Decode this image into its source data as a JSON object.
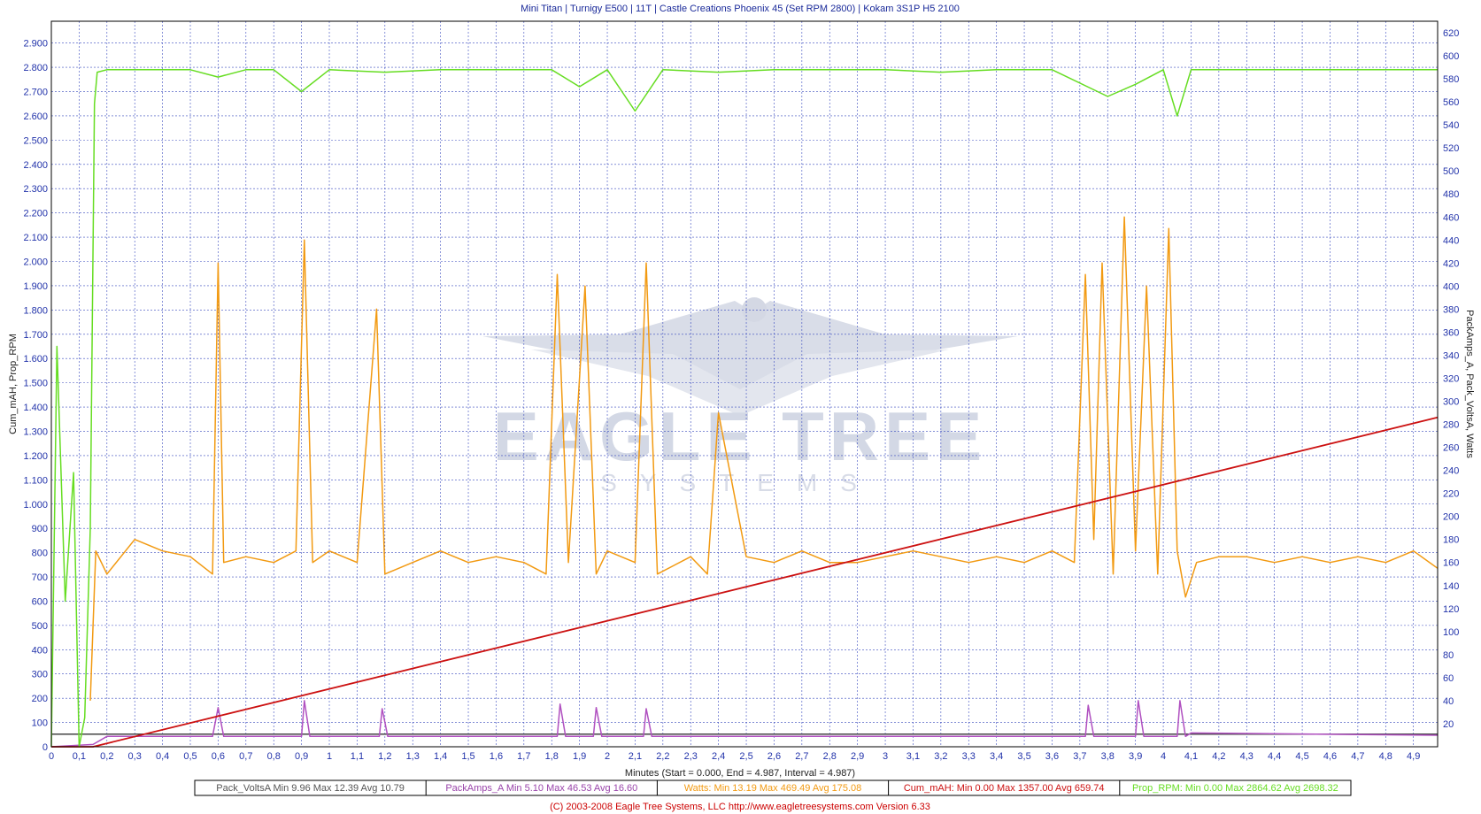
{
  "chart_data": {
    "type": "line",
    "title": "Mini Titan | Turnigy E500 | 11T | Castle Creations Phoenix 45 (Set RPM 2800) | Kokam 3S1P H5 2100",
    "xlabel": "Minutes (Start = 0.000,  End = 4.987,  Interval =  4.987)",
    "ylabel_left": "Cum_mAH, Prop_RPM",
    "ylabel_right": "PackAmps_A, Pack_VoltsA, Watts",
    "xlim": [
      0,
      4.987
    ],
    "ylim_left": [
      0,
      2990
    ],
    "ylim_right": [
      0,
      630
    ],
    "x_ticks": [
      "0",
      "0,1",
      "0,2",
      "0,3",
      "0,4",
      "0,5",
      "0,6",
      "0,7",
      "0,8",
      "0,9",
      "1",
      "1,1",
      "1,2",
      "1,3",
      "1,4",
      "1,5",
      "1,6",
      "1,7",
      "1,8",
      "1,9",
      "2",
      "2,1",
      "2,2",
      "2,3",
      "2,4",
      "2,5",
      "2,6",
      "2,7",
      "2,8",
      "2,9",
      "3",
      "3,1",
      "3,2",
      "3,3",
      "3,4",
      "3,5",
      "3,6",
      "3,7",
      "3,8",
      "3,9",
      "4",
      "4,1",
      "4,2",
      "4,3",
      "4,4",
      "4,5",
      "4,6",
      "4,7",
      "4,8",
      "4,9"
    ],
    "y_left_ticks": [
      "0",
      "100",
      "200",
      "300",
      "400",
      "500",
      "600",
      "700",
      "800",
      "900",
      "1.000",
      "1.100",
      "1.200",
      "1.300",
      "1.400",
      "1.500",
      "1.600",
      "1.700",
      "1.800",
      "1.900",
      "2.000",
      "2.100",
      "2.200",
      "2.300",
      "2.400",
      "2.500",
      "2.600",
      "2.700",
      "2.800",
      "2.900"
    ],
    "y_right_ticks": [
      "20",
      "40",
      "60",
      "80",
      "100",
      "120",
      "140",
      "160",
      "180",
      "200",
      "220",
      "240",
      "260",
      "280",
      "300",
      "320",
      "340",
      "360",
      "380",
      "400",
      "420",
      "440",
      "460",
      "480",
      "500",
      "520",
      "540",
      "560",
      "580",
      "600",
      "620"
    ],
    "grid": true,
    "series": [
      {
        "name": "Prop_RPM",
        "axis": "left",
        "color": "#66dd22",
        "x": [
          0,
          0.02,
          0.05,
          0.08,
          0.1,
          0.12,
          0.14,
          0.155,
          0.165,
          0.2,
          0.3,
          0.4,
          0.5,
          0.6,
          0.7,
          0.8,
          0.9,
          1.0,
          1.2,
          1.4,
          1.6,
          1.8,
          1.9,
          2.0,
          2.1,
          2.2,
          2.4,
          2.6,
          2.8,
          3.0,
          3.2,
          3.4,
          3.6,
          3.8,
          3.9,
          4.0,
          4.05,
          4.1,
          4.3,
          4.5,
          4.7,
          4.9,
          4.987
        ],
        "values": [
          0,
          1650,
          600,
          1130,
          0,
          120,
          900,
          2650,
          2780,
          2790,
          2790,
          2790,
          2790,
          2760,
          2790,
          2790,
          2700,
          2790,
          2780,
          2790,
          2790,
          2790,
          2720,
          2790,
          2620,
          2790,
          2780,
          2790,
          2790,
          2790,
          2780,
          2790,
          2790,
          2680,
          2730,
          2790,
          2600,
          2790,
          2790,
          2790,
          2790,
          2790,
          2790
        ]
      },
      {
        "name": "Watts",
        "axis": "right",
        "color": "#f29a12",
        "x": [
          0.14,
          0.16,
          0.2,
          0.3,
          0.4,
          0.5,
          0.58,
          0.6,
          0.62,
          0.7,
          0.8,
          0.88,
          0.91,
          0.94,
          1.0,
          1.1,
          1.17,
          1.2,
          1.3,
          1.4,
          1.5,
          1.6,
          1.7,
          1.78,
          1.82,
          1.86,
          1.92,
          1.96,
          2.0,
          2.1,
          2.14,
          2.18,
          2.3,
          2.36,
          2.4,
          2.5,
          2.6,
          2.7,
          2.8,
          2.9,
          3.0,
          3.1,
          3.2,
          3.3,
          3.4,
          3.5,
          3.6,
          3.68,
          3.72,
          3.75,
          3.78,
          3.82,
          3.86,
          3.9,
          3.94,
          3.98,
          4.02,
          4.05,
          4.08,
          4.12,
          4.2,
          4.3,
          4.4,
          4.5,
          4.6,
          4.7,
          4.8,
          4.9,
          4.987
        ],
        "values": [
          40,
          170,
          150,
          180,
          170,
          165,
          150,
          420,
          160,
          165,
          160,
          170,
          440,
          160,
          170,
          160,
          380,
          150,
          160,
          170,
          160,
          165,
          160,
          150,
          410,
          160,
          400,
          150,
          170,
          160,
          420,
          150,
          165,
          150,
          290,
          165,
          160,
          170,
          160,
          160,
          165,
          170,
          165,
          160,
          165,
          160,
          170,
          160,
          410,
          180,
          420,
          150,
          460,
          170,
          400,
          150,
          450,
          170,
          130,
          160,
          165,
          165,
          160,
          165,
          160,
          165,
          160,
          170,
          155
        ]
      },
      {
        "name": "Cum_mAH",
        "axis": "left",
        "color": "#cc1111",
        "x": [
          0,
          0.15,
          4.987
        ],
        "values": [
          0,
          0,
          1357
        ]
      },
      {
        "name": "PackAmps_A",
        "axis": "right",
        "color": "#b050c0",
        "x": [
          0,
          0.15,
          0.2,
          0.58,
          0.6,
          0.62,
          0.9,
          0.91,
          0.93,
          1.18,
          1.19,
          1.21,
          1.82,
          1.83,
          1.85,
          1.95,
          1.96,
          1.98,
          2.13,
          2.14,
          2.16,
          3.72,
          3.73,
          3.75,
          3.9,
          3.91,
          3.93,
          4.05,
          4.06,
          4.08,
          4.1,
          4.987
        ],
        "values": [
          0,
          2,
          9,
          9,
          34,
          9,
          9,
          40,
          9,
          9,
          33,
          9,
          9,
          37,
          9,
          9,
          34,
          9,
          9,
          33,
          9,
          9,
          36,
          9,
          9,
          40,
          9,
          9,
          40,
          9,
          12,
          10
        ]
      },
      {
        "name": "Pack_VoltsA",
        "axis": "right",
        "color": "#444444",
        "x": [
          0,
          4.987
        ],
        "values": [
          11,
          11
        ]
      }
    ]
  },
  "legend": [
    {
      "name": "Pack_VoltsA",
      "stats": "Min 9.96   Max 12.39   Avg 10.79",
      "color": "#555555"
    },
    {
      "name": "PackAmps_A",
      "stats": "Min 5.10   Max 46.53   Avg 16.60",
      "color": "#9944aa"
    },
    {
      "name": "Watts:",
      "stats": "Min 13.19   Max 469.49   Avg 175.08",
      "color": "#f29a12"
    },
    {
      "name": "Cum_mAH:",
      "stats": "Min 0.00   Max 1357.00   Avg 659.74",
      "color": "#cc1111"
    },
    {
      "name": "Prop_RPM:",
      "stats": "Min 0.00   Max 2864.62   Avg 2698.32",
      "color": "#66dd22"
    }
  ],
  "watermark": {
    "line1": "EAGLE TREE",
    "line2": "SYSTEMS",
    "color": "#cfd4e2"
  },
  "credits": "(C) 2003-2008 Eagle Tree Systems, LLC      http://www.eagletreesystems.com      Version 6.33"
}
